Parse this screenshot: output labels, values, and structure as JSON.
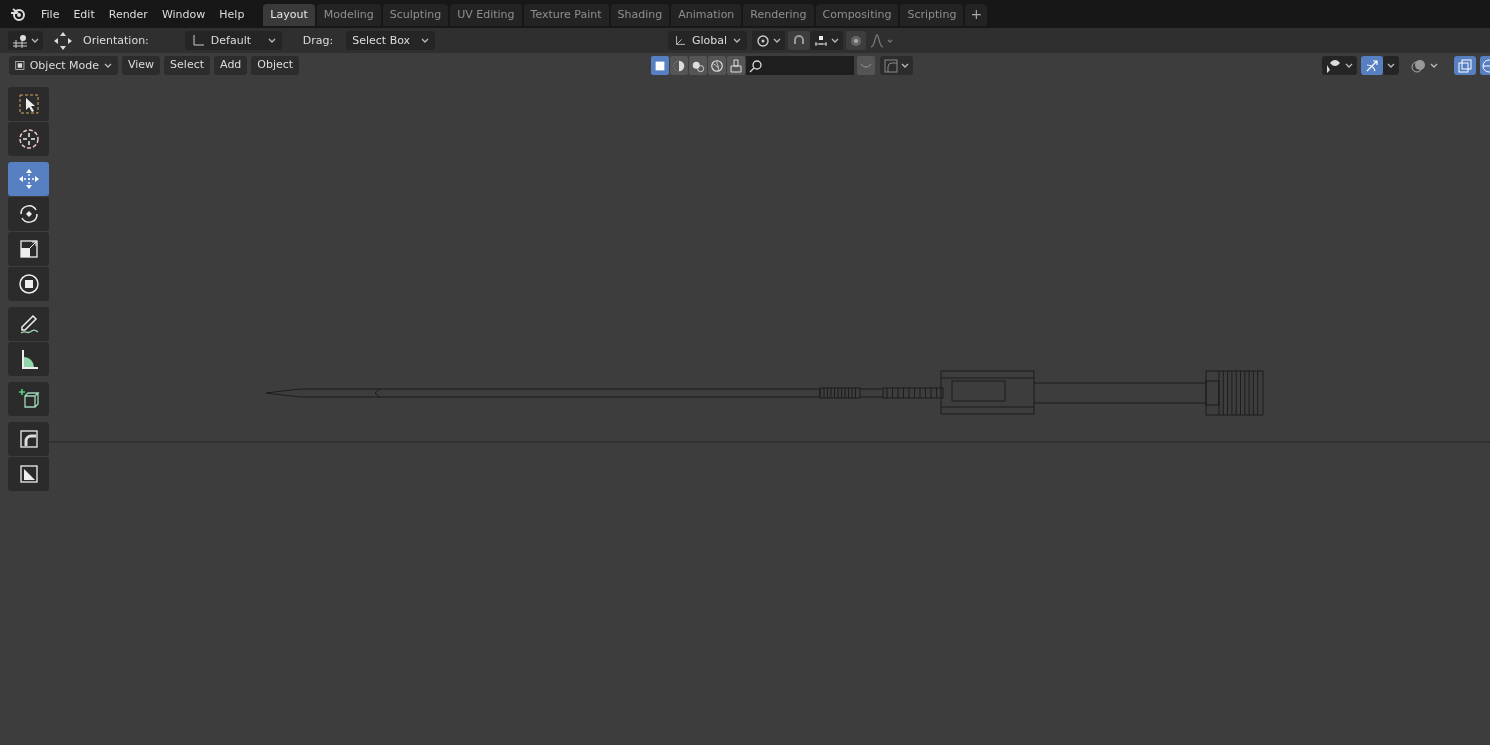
{
  "top_bar": {
    "menus": [
      "File",
      "Edit",
      "Render",
      "Window",
      "Help"
    ],
    "workspaces": [
      {
        "label": "Layout",
        "selected": true
      },
      {
        "label": "Modeling",
        "selected": false
      },
      {
        "label": "Sculpting",
        "selected": false
      },
      {
        "label": "UV Editing",
        "selected": false
      },
      {
        "label": "Texture Paint",
        "selected": false
      },
      {
        "label": "Shading",
        "selected": false
      },
      {
        "label": "Animation",
        "selected": false
      },
      {
        "label": "Rendering",
        "selected": false
      },
      {
        "label": "Compositing",
        "selected": false
      },
      {
        "label": "Scripting",
        "selected": false
      }
    ],
    "add_workspace": "+"
  },
  "tool_header": {
    "orientation_label": "Orientation:",
    "orientation": "Default",
    "drag_label": "Drag:",
    "drag": "Select Box",
    "transform_orientation": "Global",
    "snap_on": false,
    "proportional_on": false
  },
  "viewport_header": {
    "mode": "Object Mode",
    "menus": [
      "View",
      "Select",
      "Add",
      "Object"
    ],
    "shading": [
      {
        "kind": "wireframe",
        "selected": true
      },
      {
        "kind": "solid",
        "selected": false
      },
      {
        "kind": "material",
        "selected": false
      },
      {
        "kind": "rendered",
        "selected": false
      }
    ],
    "gizmos_on": true,
    "overlays_on": false,
    "xray_on": true
  },
  "toolbar": [
    {
      "kind": "select",
      "selected": false
    },
    {
      "kind": "cursor",
      "selected": false
    },
    {
      "kind": "move",
      "selected": true
    },
    {
      "kind": "rotate",
      "selected": false
    },
    {
      "kind": "scale",
      "selected": false
    },
    {
      "kind": "transform",
      "selected": false
    },
    {
      "kind": "annotate",
      "selected": false
    },
    {
      "kind": "measure",
      "selected": false
    },
    {
      "kind": "add-cube",
      "selected": false
    },
    {
      "kind": "extrude",
      "selected": false
    },
    {
      "kind": "shear",
      "selected": false
    }
  ]
}
